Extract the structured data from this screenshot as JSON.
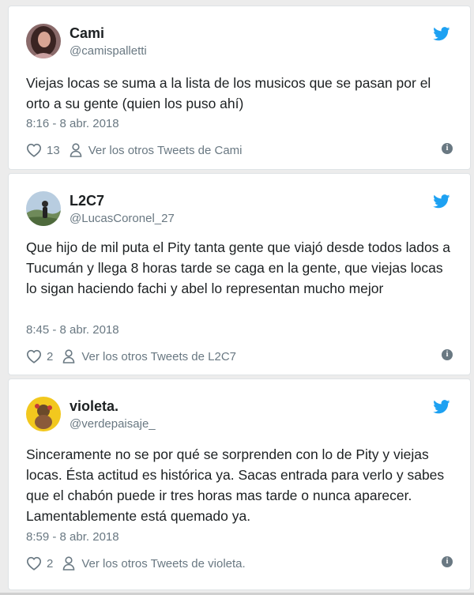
{
  "tweets": [
    {
      "name": "Cami",
      "handle": "@camispalletti",
      "text": "Viejas locas se suma a la lista de los musicos que se pasan por el orto a su gente (quien los puso ahí)",
      "time": "8:16 - 8 abr. 2018",
      "likes": "13",
      "more": "Ver los otros Tweets de Cami"
    },
    {
      "name": "L2C7",
      "handle": "@LucasCoronel_27",
      "text": "Que hijo de mil puta el Pity tanta gente que viajó desde todos lados a Tucumán y llega 8 horas tarde se caga en la gente, que viejas locas lo sigan haciendo fachi y abel lo representan mucho mejor",
      "time": "8:45 - 8 abr. 2018",
      "likes": "2",
      "more": "Ver los otros Tweets de L2C7"
    },
    {
      "name": "violeta.",
      "handle": "@verdepaisaje_",
      "text": "Sinceramente no se por qué se sorprenden con lo de Pity y viejas locas. Ésta actitud es histórica ya. Sacas entrada para verlo y sabes que el chabón puede ir tres horas mas tarde o nunca aparecer. Lamentablemente está quemado ya.",
      "time": "8:59 - 8 abr. 2018",
      "likes": "2",
      "more": "Ver los otros Tweets de violeta."
    }
  ],
  "colors": {
    "twitter_blue": "#1da1f2",
    "meta_gray": "#697882",
    "text": "#1c2022"
  },
  "icons": {
    "brand": "twitter-bird-icon",
    "like": "heart-icon",
    "profile": "person-icon",
    "info": "info-icon"
  }
}
